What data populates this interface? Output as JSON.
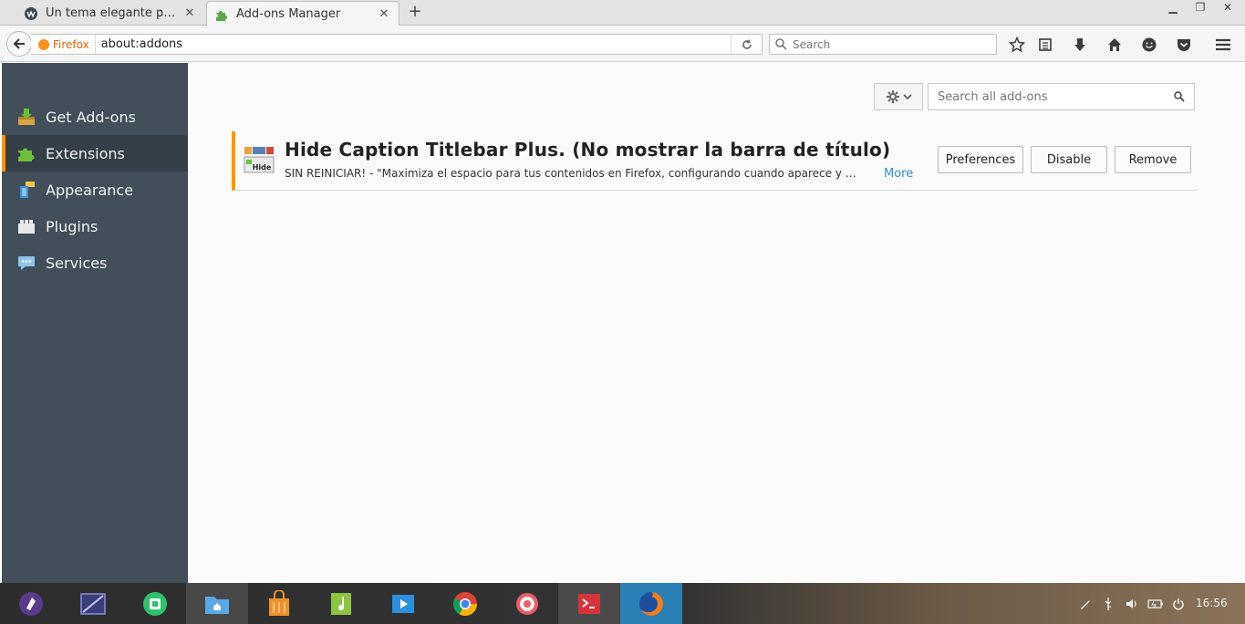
{
  "browser": {
    "tabs": [
      {
        "title": "Un tema elegante para ...",
        "active": false
      },
      {
        "title": "Add-ons Manager",
        "active": true
      }
    ],
    "new_tab_label": "+",
    "window_controls": {
      "minimize": "▁",
      "restore": "❐",
      "close": "✕"
    },
    "identity_label": "Firefox",
    "url": "about:addons",
    "search_placeholder": "Search"
  },
  "sidebar": {
    "items": [
      {
        "label": "Get Add-ons",
        "icon": "download-box-icon",
        "selected": false
      },
      {
        "label": "Extensions",
        "icon": "puzzle-piece-icon",
        "selected": true
      },
      {
        "label": "Appearance",
        "icon": "paint-roller-icon",
        "selected": false
      },
      {
        "label": "Plugins",
        "icon": "plugin-brick-icon",
        "selected": false
      },
      {
        "label": "Services",
        "icon": "chat-bubble-icon",
        "selected": false
      }
    ]
  },
  "content": {
    "search_placeholder": "Search all add-ons",
    "addon": {
      "name": "Hide Caption Titlebar Plus. (No mostrar la barra de título)",
      "description": "SIN REINICIAR! - \"Maximiza el espacio para tus contenidos en Firefox, configurando cuando aparece y el tamaño de la barra de título...",
      "more_label": "More",
      "icon_text": "Hide",
      "buttons": {
        "preferences": "Preferences",
        "disable": "Disable",
        "remove": "Remove"
      }
    }
  },
  "taskbar": {
    "apps": [
      "launcher-icon",
      "screenshot-icon",
      "store-icon",
      "files-icon",
      "shop-icon",
      "music-icon",
      "video-icon",
      "chrome-icon",
      "settings-icon",
      "terminal-icon",
      "firefox-icon"
    ],
    "clock": "16:56"
  },
  "colors": {
    "accent": "#ff9500",
    "sidebar": "#424f5a",
    "link": "#2f8ed3"
  }
}
